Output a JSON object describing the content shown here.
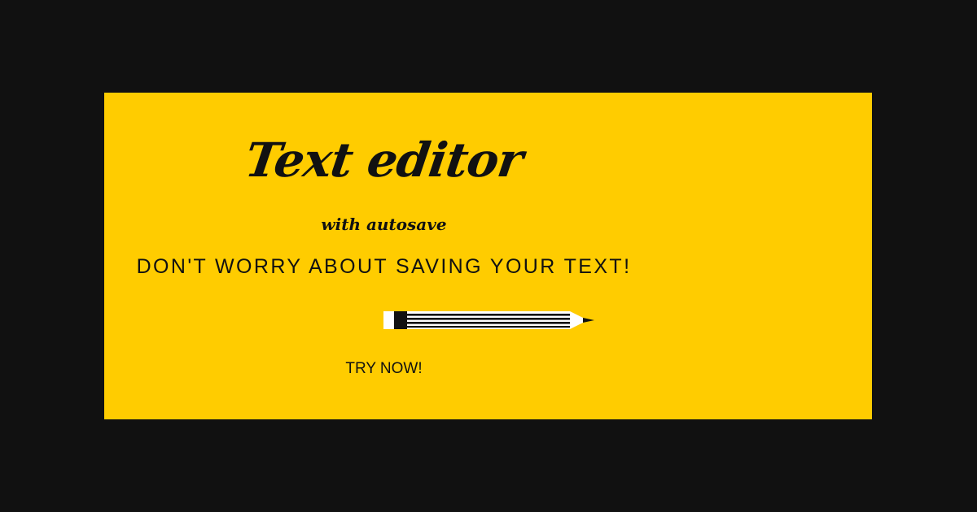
{
  "banner": {
    "title": "Text editor",
    "subtitle": "with autosave",
    "tagline": "DON'T WORRY ABOUT SAVING YOUR TEXT!",
    "cta_label": "TRY NOW!",
    "icon": "pencil-icon"
  },
  "colors": {
    "page_background": "#111111",
    "banner_background": "#ffcc00",
    "text": "#111111",
    "pencil_body": "#ffffff"
  }
}
